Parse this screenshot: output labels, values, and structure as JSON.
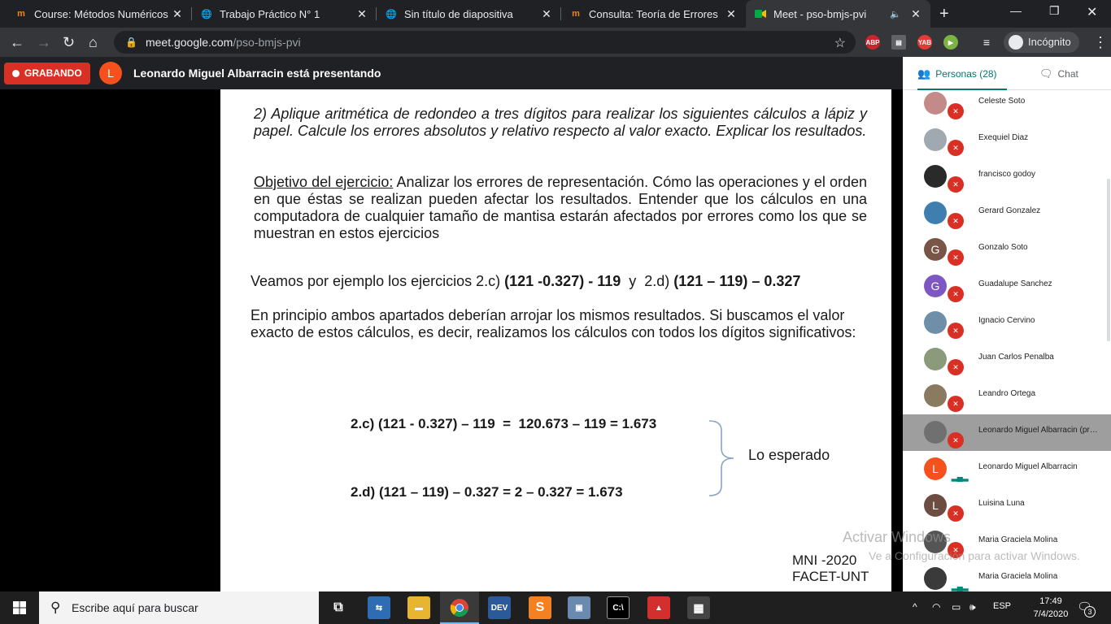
{
  "browser": {
    "tabs": [
      {
        "title": "Course: Métodos Numéricos I",
        "icon": "moodle-icon"
      },
      {
        "title": "Trabajo Práctico N° 1",
        "icon": "globe-icon"
      },
      {
        "title": "Sin título de diapositiva",
        "icon": "globe-icon"
      },
      {
        "title": "Consulta: Teoría de Errores",
        "icon": "moodle-icon"
      },
      {
        "title": "Meet - pso-bmjs-pvi",
        "icon": "meet-icon"
      }
    ],
    "url_host": "meet.google.com",
    "url_path": "/pso-bmjs-pvi",
    "extensions": [
      "ABP",
      "YAB"
    ],
    "profile_label": "Incógnito"
  },
  "meet": {
    "recording_label": "GRABANDO",
    "presenter_initial": "L",
    "presenter_text": "Leonardo Miguel Albarracin está presentando",
    "people_tab": "Personas (28)",
    "chat_tab": "Chat",
    "participants": [
      {
        "name": "Celeste Soto",
        "initial": "",
        "color": "#c48a8a",
        "status": "muted"
      },
      {
        "name": "Exequiel Diaz",
        "initial": "",
        "color": "#a0a8b0",
        "status": "muted"
      },
      {
        "name": "francisco godoy",
        "initial": "",
        "color": "#2a2a2a",
        "status": "muted"
      },
      {
        "name": "Gerard Gonzalez",
        "initial": "",
        "color": "#3f7fb0",
        "status": "muted"
      },
      {
        "name": "Gonzalo Soto",
        "initial": "G",
        "color": "#795548",
        "status": "muted"
      },
      {
        "name": "Guadalupe Sanchez",
        "initial": "G",
        "color": "#7e57c2",
        "status": "muted"
      },
      {
        "name": "Ignacio Cervino",
        "initial": "",
        "color": "#6f8fa8",
        "status": "muted"
      },
      {
        "name": "Juan Carlos Penalba",
        "initial": "",
        "color": "#8a9a7a",
        "status": "muted"
      },
      {
        "name": "Leandro Ortega",
        "initial": "",
        "color": "#8a7a60",
        "status": "muted"
      },
      {
        "name": "Leonardo Miguel Albarracin (presentación)",
        "initial": "",
        "color": "#707070",
        "status": "muted"
      },
      {
        "name": "Leonardo Miguel Albarracin",
        "initial": "L",
        "color": "#f4511e",
        "status": "talking"
      },
      {
        "name": "Luisina Luna",
        "initial": "L",
        "color": "#6d4c41",
        "status": "muted"
      },
      {
        "name": "Maria Graciela Molina",
        "initial": "",
        "color": "#555555",
        "status": "muted"
      },
      {
        "name": "Maria Graciela Molina",
        "initial": "",
        "color": "#3a3a3a",
        "status": "talking"
      }
    ]
  },
  "slide": {
    "question": "2) Aplique aritmética de redondeo a tres dígitos para realizar los siguientes cálculos a lápiz y papel. Calcule los errores absolutos y relativo respecto al valor exacto. Explicar los resultados.",
    "objective_label": "Objetivo del ejercicio:",
    "objective_text": " Analizar los errores de representación. Cómo las operaciones y el orden en que éstas se realizan pueden afectar los resultados. Entender que los cálculos en una computadora de cualquier tamaño de mantisa estarán afectados por errores como los que se muestran en estos ejercicios",
    "example_prefix": "Veamos por ejemplo los ejercicios 2.c) ",
    "example_c": "(121 -0.327) - 119",
    "example_mid": "  y  2.d) ",
    "example_d": "(121 – 119) – 0.327",
    "principle": "En principio ambos apartados deberían arrojar los mismos resultados. Si buscamos el valor exacto de estos cálculos, es decir, realizamos los cálculos con todos los dígitos significativos:",
    "eq_c": "2.c) (121 - 0.327) – 119  =  120.673 – 119 = 1.673",
    "eq_d": "2.d) (121 – 119) – 0.327 = 2 – 0.327 = 1.673",
    "expected": "Lo esperado",
    "footer_1": "MNI -2020",
    "footer_2": "FACET-UNT"
  },
  "windows": {
    "watermark_title": "Activar Windows",
    "watermark_sub": "Ve a Configuración para activar Windows.",
    "search_placeholder": "Escribe aquí para buscar",
    "taskbar_apps": [
      "task-view",
      "network",
      "file-explorer",
      "chrome",
      "dev",
      "sublime",
      "vm",
      "terminal",
      "acrobat",
      "calculator"
    ],
    "language": "ESP",
    "time": "17:49",
    "date": "7/4/2020",
    "notifications": "3"
  }
}
